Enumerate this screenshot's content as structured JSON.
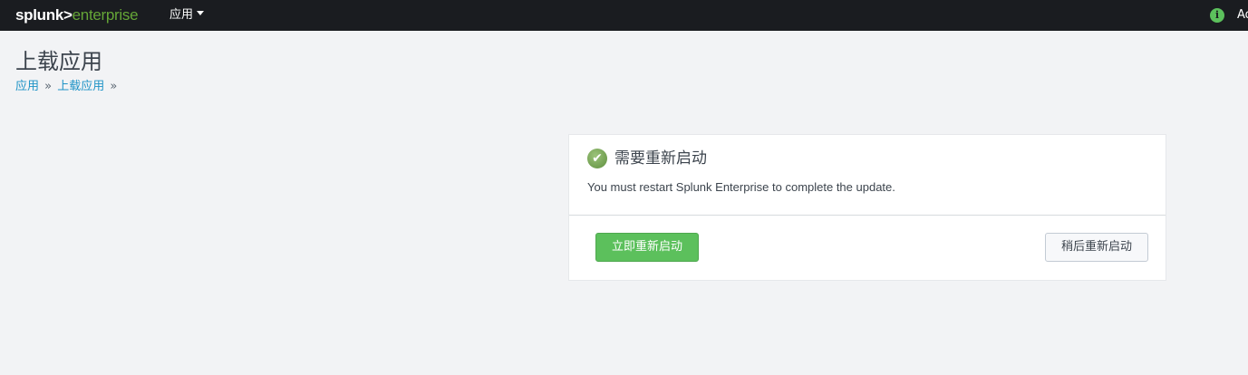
{
  "header": {
    "logo_part1": "splunk",
    "logo_part2": ">",
    "logo_part3": "enterprise",
    "apps_menu_label": "应用",
    "info_icon": "info-circle-icon",
    "user_menu_label": "Ad"
  },
  "page": {
    "title": "上载应用",
    "breadcrumb": [
      {
        "label": "应用"
      },
      {
        "label": "上载应用"
      }
    ],
    "breadcrumb_sep": "»"
  },
  "dialog": {
    "icon": "check-circle-icon",
    "title": "需要重新启动",
    "message": "You must restart Splunk Enterprise to complete the update.",
    "restart_now_label": "立即重新启动",
    "restart_later_label": "稍后重新启动"
  },
  "colors": {
    "header_bg": "#1a1c20",
    "accent_green": "#5cc05c",
    "link_blue": "#1e93c6",
    "page_bg": "#f2f3f5"
  }
}
